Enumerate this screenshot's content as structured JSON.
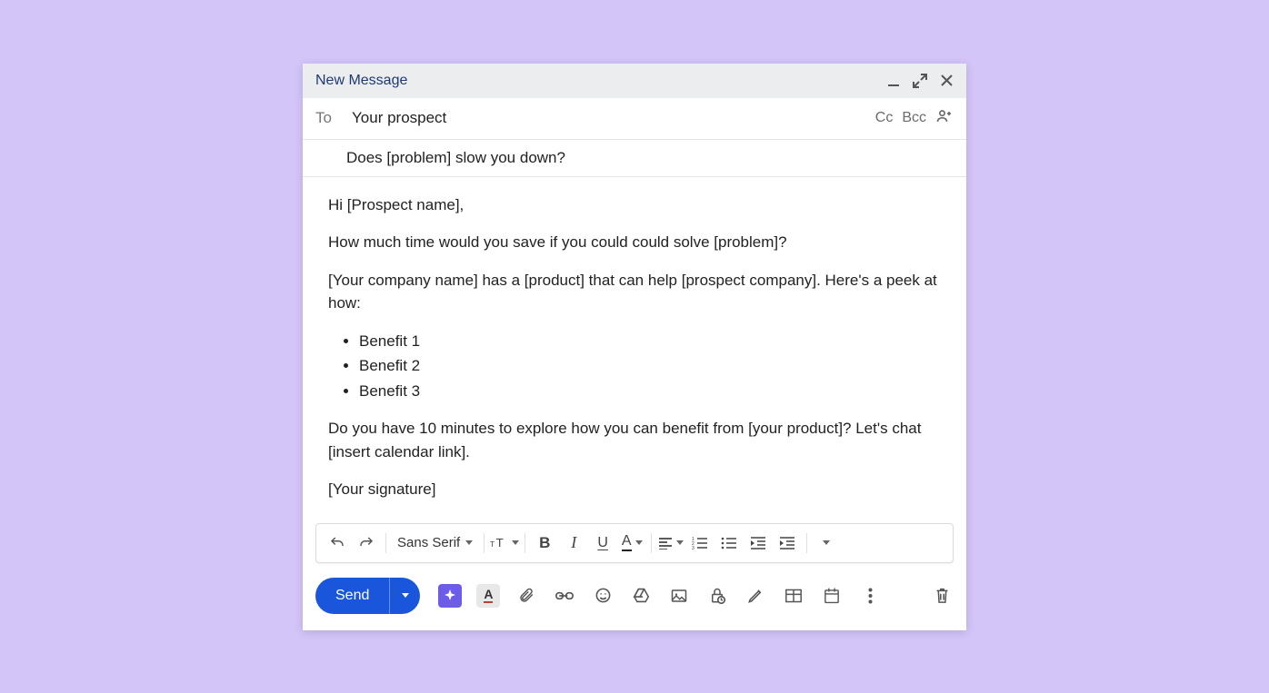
{
  "titlebar": {
    "title": "New Message"
  },
  "to": {
    "label": "To",
    "value": "Your prospect",
    "cc": "Cc",
    "bcc": "Bcc"
  },
  "subject": {
    "value": "Does [problem] slow you down?"
  },
  "body": {
    "greeting": "Hi [Prospect name],",
    "p1": "How much time would you save if you could could solve [problem]?",
    "p2": "[Your company name] has a [product] that can help [prospect company]. Here's a peek at how:",
    "benefits": [
      "Benefit 1",
      "Benefit 2",
      "Benefit 3"
    ],
    "p3": "Do you have 10 minutes to explore how you can benefit from [your product]? Let's chat [insert calendar link].",
    "signature": "[Your signature]"
  },
  "toolbar": {
    "font": "Sans Serif",
    "bold": "B",
    "italic": "I",
    "underline": "U",
    "textcolor": "A"
  },
  "send": {
    "label": "Send"
  }
}
